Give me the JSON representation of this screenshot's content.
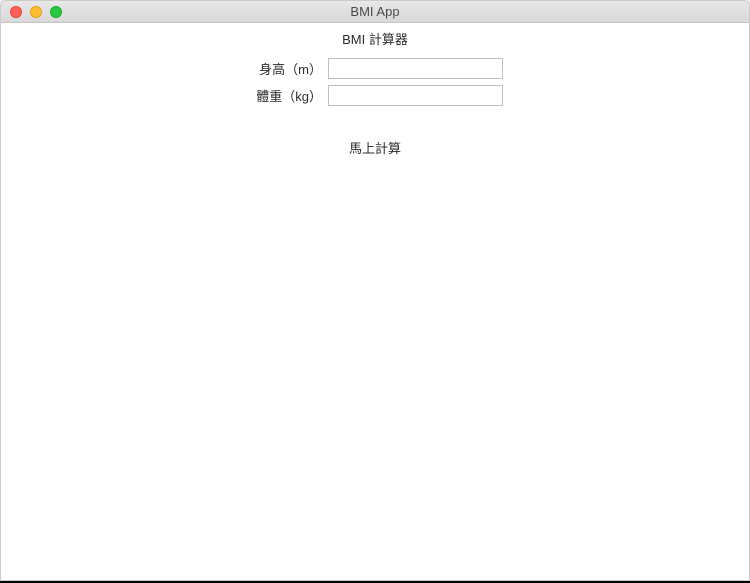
{
  "window": {
    "title": "BMI App"
  },
  "app": {
    "heading": "BMI 計算器"
  },
  "form": {
    "height_label": "身高（m）",
    "height_value": "",
    "weight_label": "體重（kg）",
    "weight_value": "",
    "calculate_label": "馬上計算"
  }
}
